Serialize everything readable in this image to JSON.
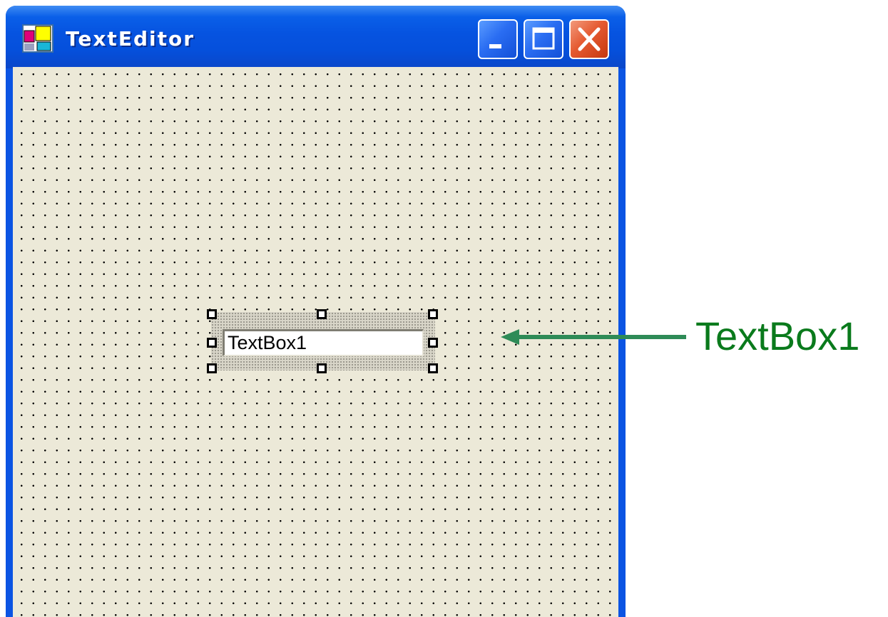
{
  "window": {
    "title": "TextEditor",
    "icon": "form-icon",
    "controls": {
      "minimize_icon": "minimize-icon",
      "maximize_icon": "maximize-icon",
      "close_icon": "close-icon"
    }
  },
  "form": {
    "textbox": {
      "text": "TextBox1",
      "selected": true
    }
  },
  "annotation": {
    "label": "TextBox1",
    "color": "#0a7a1c",
    "arrow_color": "#2e8b57"
  },
  "colors": {
    "titlebar": "#0653e0",
    "close_button": "#e55a31",
    "form_background": "#ece9d8"
  }
}
